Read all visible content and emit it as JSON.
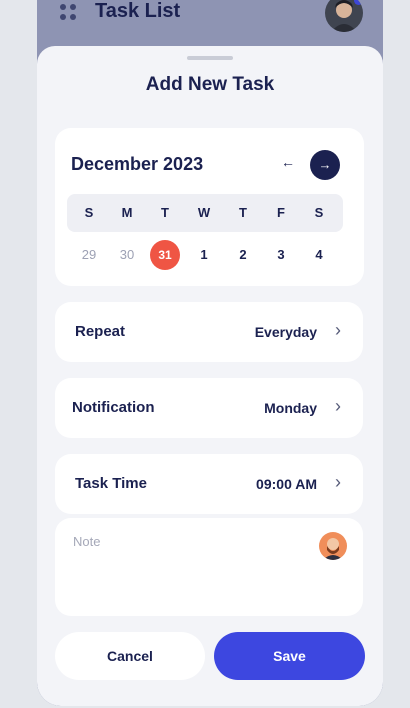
{
  "header": {
    "title": "Task List",
    "menu_icon": "dots-grid-icon",
    "avatar_icon": "user-avatar"
  },
  "sheet": {
    "title": "Add New Task"
  },
  "calendar": {
    "month_label": "December 2023",
    "prev_icon": "arrow-left-icon",
    "next_icon": "arrow-right-icon",
    "weekdays": [
      "S",
      "M",
      "T",
      "W",
      "T",
      "F",
      "S"
    ],
    "days": [
      "29",
      "30",
      "31",
      "1",
      "2",
      "3",
      "4"
    ],
    "selected_day": "31",
    "selected_color": "#ef5544"
  },
  "settings": {
    "repeat": {
      "label": "Repeat",
      "value": "Everyday"
    },
    "notification": {
      "label": "Notification",
      "value": "Monday"
    },
    "task_time": {
      "label": "Task Time",
      "value": "09:00 AM"
    }
  },
  "note": {
    "placeholder": "Note"
  },
  "actions": {
    "cancel_label": "Cancel",
    "save_label": "Save",
    "accent": "#3d47e0"
  }
}
